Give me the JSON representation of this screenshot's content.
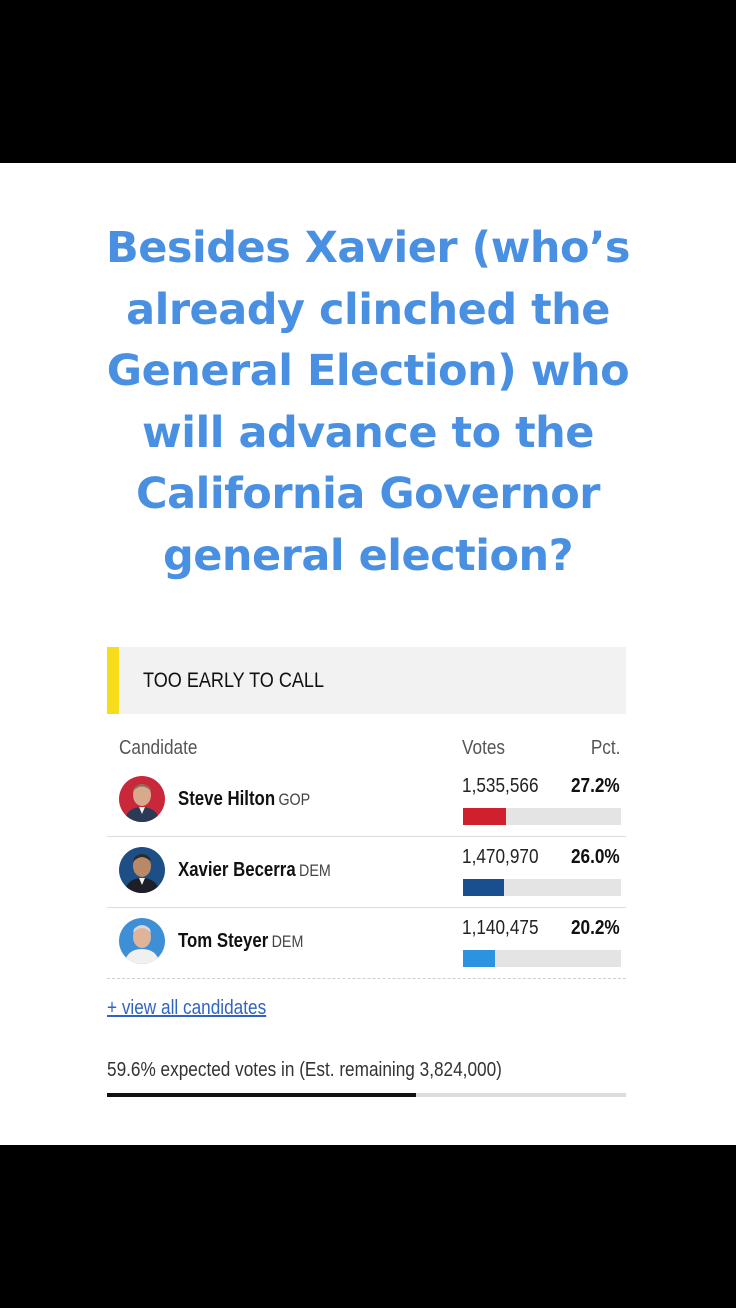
{
  "headline": "Besides Xavier (who’s already clinched the General Election) who will advance to the California Governor general election?",
  "status": "TOO EARLY TO CALL",
  "colors": {
    "status_accent": "#f7dc1c",
    "headline": "#4a90e2",
    "gop": "#d0202e",
    "dem": "#1a4f8f",
    "dem_light": "#2b93e0"
  },
  "table": {
    "headers": {
      "candidate": "Candidate",
      "votes": "Votes",
      "pct": "Pct."
    },
    "rows": [
      {
        "name": "Steve Hilton",
        "party": "GOP",
        "votes": "1,535,566",
        "pct": "27.2%",
        "share": 0.272,
        "bar_color": "#d0202e",
        "avatar_icon": "steve-hilton-photo"
      },
      {
        "name": "Xavier Becerra",
        "party": "DEM",
        "votes": "1,470,970",
        "pct": "26.0%",
        "share": 0.26,
        "bar_color": "#1a4f8f",
        "avatar_icon": "xavier-becerra-photo"
      },
      {
        "name": "Tom Steyer",
        "party": "DEM",
        "votes": "1,140,475",
        "pct": "20.2%",
        "share": 0.202,
        "bar_color": "#2b93e0",
        "avatar_icon": "tom-steyer-photo"
      }
    ]
  },
  "view_all": "+ view all candidates",
  "expected": {
    "text": "59.6% expected votes in (Est. remaining 3,824,000)",
    "progress": 0.596
  }
}
